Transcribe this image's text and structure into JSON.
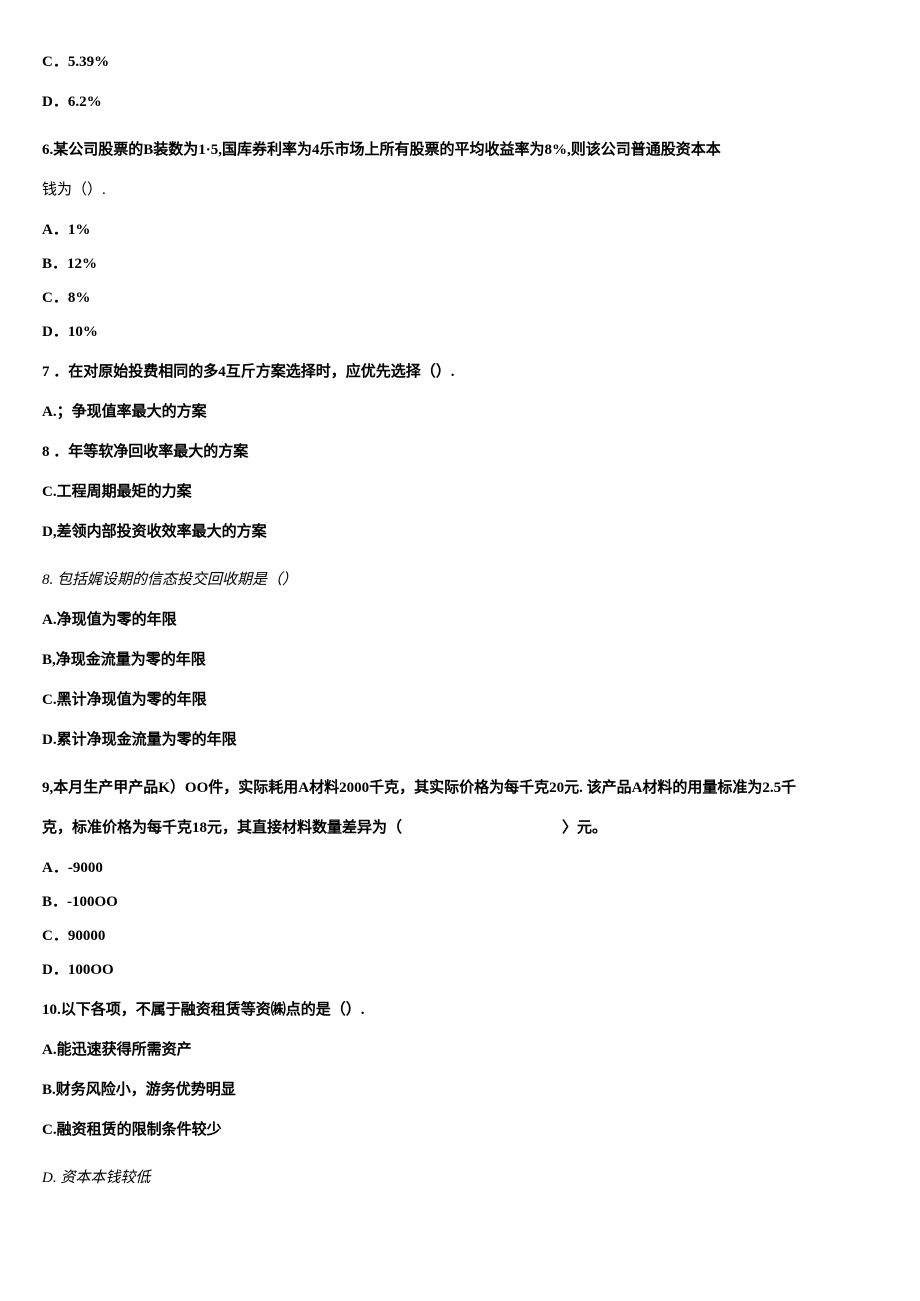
{
  "lines": {
    "c5": "C．5.39%",
    "d5": "D．6.2%",
    "q6_stem": "6.某公司股票的B装数为1·5,国库券利率为4乐市场上所有股票的平均收益率为8%,则该公司普通股资本本",
    "q6_stem2": "钱为（）.",
    "q6_a": "A．1%",
    "q6_b": "B．12%",
    "q6_c": "C．8%",
    "q6_d": "D．10%",
    "q7_stem": "7 ．在对原始投费相同的多4互斤方案选择时，应优先选择（）.",
    "q7_a": "A.；争现值率最大的方案",
    "q7_b": "8 ．年等软净回收率最大的方案",
    "q7_c": "C.工程周期最矩的力案",
    "q7_d": "D,差领内部投资收效率最大的方案",
    "q8_stem": "8. 包括娓设期的信态投交回收期是（）",
    "q8_a": "A.净现值为零的年限",
    "q8_b": "B,净现金流量为零的年限",
    "q8_c": "C.黑计净现值为零的年限",
    "q8_d": "D.累计净现金流量为零的年限",
    "q9_stem": "9,本月生产甲产品K）OO件，实际耗用A材料2000千克，其实际价格为每千克20元. 该产品A材料的用量标准为2.5千",
    "q9_stem2_a": "克，标准价格为每千克18元，其直接材料数量差异为（",
    "q9_stem2_b": "〉元。",
    "q9_a": "A．-9000",
    "q9_b": "B．-100OO",
    "q9_c": "C．90000",
    "q9_d": "D．100OO",
    "q10_stem": "10.以下各项，不属于融资租赁等资㈱点的是（）.",
    "q10_a": "A.能迅速获得所需资产",
    "q10_b": "B.财务风险小，游务优势明显",
    "q10_c": "C.融资租赁的限制条件较少",
    "q10_d": "D. 资本本钱较低"
  }
}
